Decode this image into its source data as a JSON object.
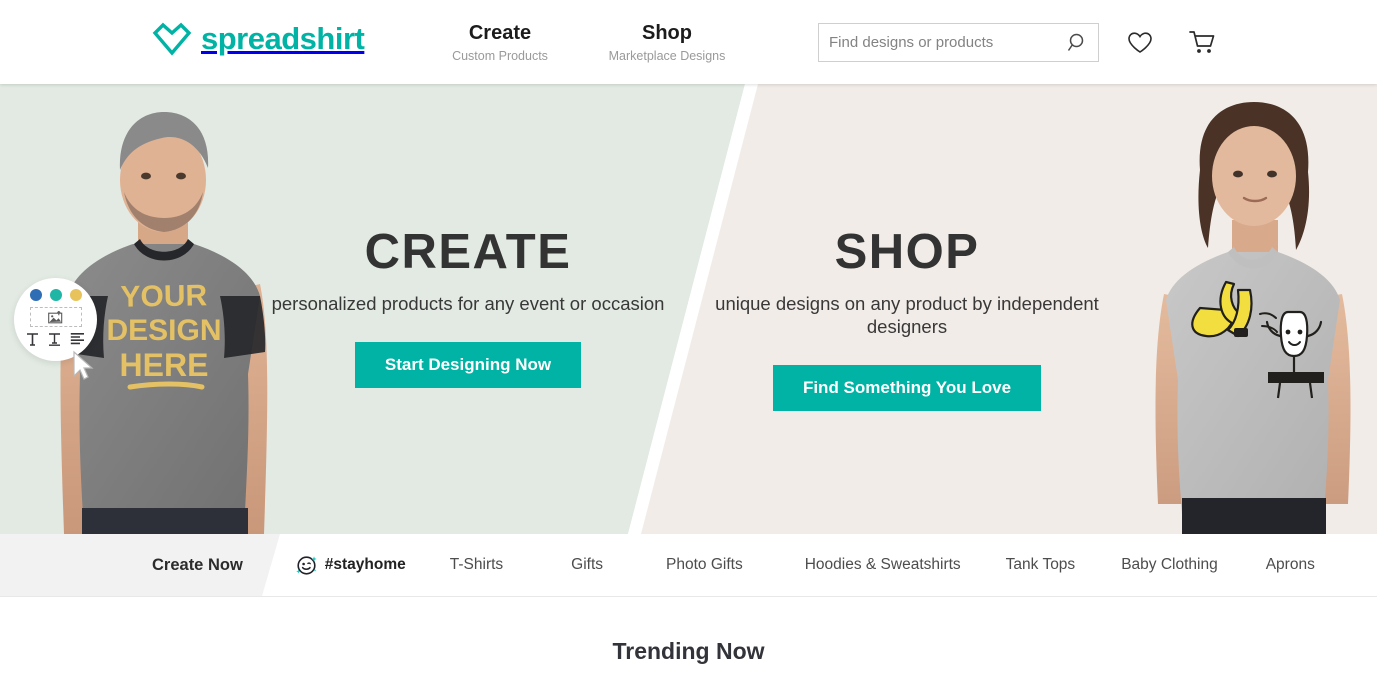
{
  "header": {
    "logo_text": "spreadshirt",
    "logo_icon": "heart-diamond-icon",
    "brand_color": "#00b3a4",
    "nav": [
      {
        "title": "Create",
        "subtitle": "Custom Products"
      },
      {
        "title": "Shop",
        "subtitle": "Marketplace Designs"
      }
    ],
    "search": {
      "placeholder": "Find designs or products",
      "value": "",
      "icon": "search-icon"
    },
    "wishlist_icon": "heart-outline-icon",
    "cart_icon": "shopping-cart-icon"
  },
  "hero": {
    "left_bg": "#e2eae3",
    "right_bg": "#f1ece7",
    "left": {
      "title": "CREATE",
      "subtitle": "personalized products for any event or occasion",
      "button": "Start Designing Now",
      "shirt_design_text": "YOUR DESIGN HERE"
    },
    "right": {
      "title": "SHOP",
      "subtitle": "unique designs on any product by independent designers",
      "button": "Find Something You Love",
      "shirt_design_text": "banana-peel-design"
    },
    "badge": {
      "dot_colors": [
        "#2f6eb5",
        "#1fb6a6",
        "#e8c35c"
      ],
      "image_icon": "image-upload-icon",
      "tool_icons": [
        "text-tool-icon",
        "text-style-icon",
        "text-align-icon"
      ],
      "cursor_icon": "cursor-pointer-icon"
    }
  },
  "category_nav": {
    "items": [
      {
        "label": "Create Now",
        "type": "active"
      },
      {
        "label": "#stayhome",
        "type": "tag",
        "icon": "smiley-sparkle-icon"
      },
      {
        "label": "T-Shirts",
        "type": "normal"
      },
      {
        "label": "Gifts",
        "type": "normal"
      },
      {
        "label": "Photo Gifts",
        "type": "normal"
      },
      {
        "label": "Hoodies & Sweatshirts",
        "type": "normal"
      },
      {
        "label": "Tank Tops",
        "type": "normal"
      },
      {
        "label": "Baby Clothing",
        "type": "normal"
      },
      {
        "label": "Aprons",
        "type": "normal"
      }
    ]
  },
  "trending": {
    "title": "Trending Now"
  }
}
